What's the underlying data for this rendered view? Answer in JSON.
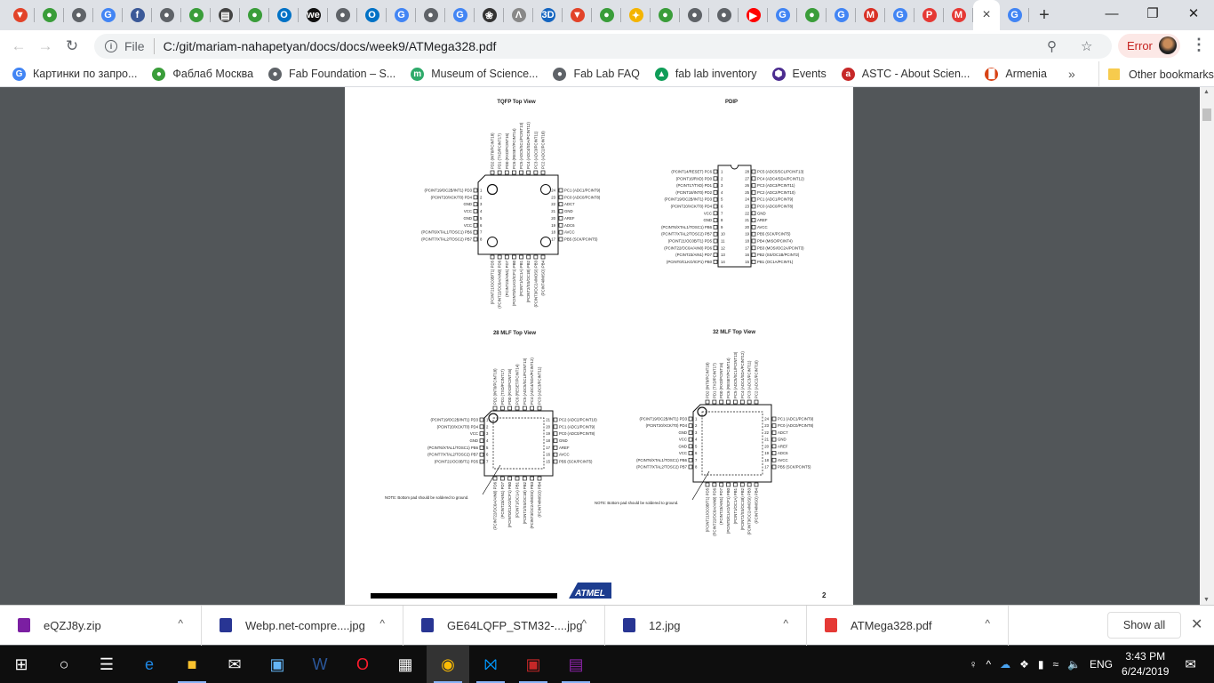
{
  "browser": {
    "tabs": [
      {
        "icon": "gitlab-icon",
        "color": "#e24329",
        "glyph": "▼"
      },
      {
        "icon": "fablab-icon",
        "color": "#3a9d3a",
        "glyph": "●"
      },
      {
        "icon": "globe-icon",
        "color": "#5f6368",
        "glyph": "●"
      },
      {
        "icon": "google-icon",
        "color": "#4285f4",
        "glyph": "G"
      },
      {
        "icon": "facebook-icon",
        "color": "#3b5998",
        "glyph": "f"
      },
      {
        "icon": "globe-icon",
        "color": "#5f6368",
        "glyph": "●"
      },
      {
        "icon": "fablab-icon",
        "color": "#3a9d3a",
        "glyph": "●"
      },
      {
        "icon": "book-icon",
        "color": "#444",
        "glyph": "▤"
      },
      {
        "icon": "fablab-icon",
        "color": "#3a9d3a",
        "glyph": "●"
      },
      {
        "icon": "outlook-icon",
        "color": "#0072c6",
        "glyph": "O"
      },
      {
        "icon": "we-icon",
        "color": "#111",
        "glyph": "we"
      },
      {
        "icon": "globe-icon",
        "color": "#5f6368",
        "glyph": "●"
      },
      {
        "icon": "outlook-icon",
        "color": "#0072c6",
        "glyph": "O"
      },
      {
        "icon": "google-translate-icon",
        "color": "#4285f4",
        "glyph": "G"
      },
      {
        "icon": "globe-icon",
        "color": "#5f6368",
        "glyph": "●"
      },
      {
        "icon": "google-icon",
        "color": "#4285f4",
        "glyph": "G"
      },
      {
        "icon": "reel-icon",
        "color": "#333",
        "glyph": "❀"
      },
      {
        "icon": "lambda-icon",
        "color": "#888",
        "glyph": "Λ"
      },
      {
        "icon": "3d-icon",
        "color": "#1565c0",
        "glyph": "3D"
      },
      {
        "icon": "gitlab-icon",
        "color": "#e24329",
        "glyph": "▼"
      },
      {
        "icon": "fablab-icon",
        "color": "#3a9d3a",
        "glyph": "●"
      },
      {
        "icon": "pinwheel-icon",
        "color": "#f4b400",
        "glyph": "✦"
      },
      {
        "icon": "fablab-icon",
        "color": "#3a9d3a",
        "glyph": "●"
      },
      {
        "icon": "globe-icon",
        "color": "#5f6368",
        "glyph": "●"
      },
      {
        "icon": "globe-icon",
        "color": "#5f6368",
        "glyph": "●"
      },
      {
        "icon": "youtube-icon",
        "color": "#ff0000",
        "glyph": "▶"
      },
      {
        "icon": "google-icon",
        "color": "#4285f4",
        "glyph": "G"
      },
      {
        "icon": "fablab-icon",
        "color": "#3a9d3a",
        "glyph": "●"
      },
      {
        "icon": "google-icon",
        "color": "#4285f4",
        "glyph": "G"
      },
      {
        "icon": "gmail-icon",
        "color": "#d93025",
        "glyph": "M"
      },
      {
        "icon": "google-icon",
        "color": "#4285f4",
        "glyph": "G"
      },
      {
        "icon": "pdf-icon",
        "color": "#e53935",
        "glyph": "P"
      },
      {
        "icon": "microchip-icon",
        "color": "#e53935",
        "glyph": "M"
      }
    ],
    "active_tab_close": "×",
    "after_tab": {
      "icon": "google-icon",
      "color": "#4285f4",
      "glyph": "G"
    },
    "new_tab": "+",
    "window": {
      "minimize": "—",
      "restore": "❐",
      "close": "✕"
    },
    "file_label": "File",
    "url": "C:/git/mariam-nahapetyan/docs/docs/week9/ATMega328.pdf",
    "profile_status": "Error",
    "bookmarks": [
      {
        "label": "Картинки по запро...",
        "icon": "google-icon",
        "color": "#4285f4",
        "glyph": "G"
      },
      {
        "label": "Фаблаб Москва",
        "icon": "fablab-icon",
        "color": "#3a9d3a",
        "glyph": "●"
      },
      {
        "label": "Fab Foundation – S...",
        "icon": "globe-icon",
        "color": "#5f6368",
        "glyph": "●"
      },
      {
        "label": "Museum of Science...",
        "icon": "museum-icon",
        "color": "#2eaa6a",
        "glyph": "m"
      },
      {
        "label": "Fab Lab FAQ",
        "icon": "globe-icon",
        "color": "#5f6368",
        "glyph": "●"
      },
      {
        "label": "fab lab inventory",
        "icon": "google-drive-icon",
        "color": "#0f9d58",
        "glyph": "▲"
      },
      {
        "label": "Events",
        "icon": "hexagon-icon",
        "color": "#4b2c8f",
        "glyph": "⬢"
      },
      {
        "label": "ASTC - About Scien...",
        "icon": "astc-icon",
        "color": "#c62828",
        "glyph": "a"
      },
      {
        "label": "Armenia",
        "icon": "armenia-icon",
        "color": "#d84315",
        "glyph": "█"
      }
    ],
    "bookmarks_more": "»",
    "other_bookmarks": "Other bookmarks"
  },
  "pdf": {
    "page_number": "2",
    "tqfp": {
      "title": "TQFP Top View",
      "pins": [
        "(PCINT19/OC2B/INT1) PD3",
        "(PCINT20/XCK/T0) PD4",
        "GND",
        "VCC",
        "GND",
        "VCC",
        "(PCINT6/XTAL1/TOSC1) PB6",
        "(PCINT7/XTAL2/TOSC2) PB7",
        "(PCINT21/OC0B/T1) PD5",
        "(PCINT22/OC0A/AIN0) PD6",
        "(PCINT23/AIN1) PD7",
        "(PCINT0/CLKO/ICP1) PB0",
        "(PCINT1/OC1A) PB1",
        "(PCINT2/SS/OC1B) PB2",
        "(PCINT3/OC2A/MOSI) PB3",
        "(PCINT4/MISO) PB4",
        "PB5 (SCK/PCINT5)",
        "AVCC",
        "ADC6",
        "AREF",
        "GND",
        "ADC7",
        "PC0 (ADC0/PCINT8)",
        "PC1 (ADC1/PCINT9)",
        "PC2 (ADC2/PCINT10)",
        "PC3 (ADC3/PCINT11)",
        "PC4 (ADC4/SDA/PCINT12)",
        "PC5 (ADC5/SCL/PCINT13)",
        "PC6 (RESET/PCINT14)",
        "PD0 (RXD/PCINT16)",
        "PD1 (TXD/PCINT17)",
        "PD2 (INT0/PCINT18)"
      ]
    },
    "pdip": {
      "title": "PDIP",
      "pins": [
        "(PCINT14/RESET) PC6",
        "(PCINT16/RXD) PD0",
        "(PCINT17/TXD) PD1",
        "(PCINT18/INT0) PD2",
        "(PCINT19/OC2B/INT1) PD3",
        "(PCINT20/XCK/T0) PD4",
        "VCC",
        "GND",
        "(PCINT6/XTAL1/TOSC1) PB6",
        "(PCINT7/XTAL2/TOSC2) PB7",
        "(PCINT21/OC0B/T1) PD5",
        "(PCINT22/OC0A/AIN0) PD6",
        "(PCINT23/AIN1) PD7",
        "(PCINT0/CLKO/ICP1) PB0",
        "PB1 (OC1A/PCINT1)",
        "PB2 (SS/OC1B/PCINT2)",
        "PB3 (MOSI/OC2A/PCINT3)",
        "PB4 (MISO/PCINT4)",
        "PB5 (SCK/PCINT5)",
        "AVCC",
        "AREF",
        "GND",
        "PC0 (ADC0/PCINT8)",
        "PC1 (ADC1/PCINT9)",
        "PC2 (ADC2/PCINT10)",
        "PC3 (ADC3/PCINT11)",
        "PC4 (ADC4/SDA/PCINT12)",
        "PC5 (ADC5/SCL/PCINT13)"
      ]
    },
    "mlf28": {
      "title": "28 MLF Top View",
      "note": "NOTE:  Bottom pad should be soldered to ground.",
      "pins": [
        "(PCINT19/OC2B/INT1) PD3",
        "(PCINT20/XCK/T0) PD4",
        "VCC",
        "GND",
        "(PCINT6/XTAL1/TOSC1) PB6",
        "(PCINT7/XTAL2/TOSC2) PB7",
        "(PCINT21/OC0B/T1) PD5",
        "(PCINT22/OC0A/AIN0) PD6",
        "(PCINT23/AIN1) PD7",
        "(PCINT0/CLKO/ICP1) PB0",
        "(PCINT1/OC1A) PB1",
        "(PCINT2/SS/OC1B) PB2",
        "(PCINT3/OC2A/MOSI) PB3",
        "(PCINT4/MISO) PB4",
        "PB5 (SCK/PCINT5)",
        "AVCC",
        "AREF",
        "GND",
        "PC0 (ADC0/PCINT8)",
        "PC1 (ADC1/PCINT9)",
        "PC2 (ADC2/PCINT10)",
        "PC3 (ADC3/PCINT11)",
        "PC4 (ADC4/SDA/PCINT12)",
        "PC5 (ADC5/SCL/PCINT13)",
        "PC6 (RESET/PCINT14)",
        "PD0 (RXD/PCINT16)",
        "PD1 (TXD/PCINT17)",
        "PD2 (INT0/PCINT18)"
      ]
    },
    "mlf32": {
      "title": "32 MLF Top View",
      "note": "NOTE:  Bottom pad should be soldered to ground.",
      "pins": [
        "(PCINT19/OC2B/INT1) PD3",
        "(PCINT20/XCK/T0) PD4",
        "GND",
        "VCC",
        "GND",
        "VCC",
        "(PCINT6/XTAL1/TOSC1) PB6",
        "(PCINT7/XTAL2/TOSC2) PB7",
        "(PCINT21/OC0B/T1) PD5",
        "(PCINT22/OC0A/AIN0) PD6",
        "(PCINT23/AIN1) PD7",
        "(PCINT0/CLKO/ICP1) PB0",
        "(PCINT1/OC1A) PB1",
        "(PCINT2/SS/OC1B) PB2",
        "(PCINT3/OC2A/MOSI) PB3",
        "(PCINT4/MISO) PB4",
        "PB5 (SCK/PCINT5)",
        "AVCC",
        "ADC6",
        "AREF",
        "GND",
        "ADC7",
        "PC0 (ADC0/PCINT8)",
        "PC1 (ADC1/PCINT9)",
        "PC2 (ADC2/PCINT10)",
        "PC3 (ADC3/PCINT11)",
        "PC4 (ADC4/SDA/PCINT12)",
        "PC5 (ADC5/SCL/PCINT13)",
        "PC6 (RESET/PCINT14)",
        "PD0 (RXD/PCINT16)",
        "PD1 (TXD/PCINT17)",
        "PD2 (INT0/PCINT18)"
      ]
    },
    "logo": "ATMEL"
  },
  "downloads": {
    "items": [
      {
        "name": "eQZJ8y.zip",
        "color": "#7b1fa2"
      },
      {
        "name": "Webp.net-compre....jpg",
        "color": "#283593"
      },
      {
        "name": "GE64LQFP_STM32-....jpg",
        "color": "#283593"
      },
      {
        "name": "12.jpg",
        "color": "#283593"
      },
      {
        "name": "ATMega328.pdf",
        "color": "#e53935"
      }
    ],
    "caret": "^",
    "show_all": "Show all",
    "close": "✕"
  },
  "taskbar": {
    "apps": [
      {
        "name": "start",
        "glyph": "⊞",
        "color": "#fff",
        "open": false
      },
      {
        "name": "cortana",
        "glyph": "○",
        "color": "#fff",
        "open": false
      },
      {
        "name": "task-view",
        "glyph": "☰",
        "color": "#fff",
        "open": false
      },
      {
        "name": "edge",
        "glyph": "e",
        "color": "#1e88e5",
        "open": false
      },
      {
        "name": "file-explorer",
        "glyph": "■",
        "color": "#f9c22e",
        "open": true
      },
      {
        "name": "mail",
        "glyph": "✉",
        "color": "#fff",
        "open": false
      },
      {
        "name": "remote",
        "glyph": "▣",
        "color": "#64b5f6",
        "open": false
      },
      {
        "name": "word",
        "glyph": "W",
        "color": "#2b579a",
        "open": false
      },
      {
        "name": "opera",
        "glyph": "O",
        "color": "#ff1b2d",
        "open": false
      },
      {
        "name": "store",
        "glyph": "▦",
        "color": "#fff",
        "open": false
      },
      {
        "name": "chrome",
        "glyph": "◉",
        "color": "#fbbc05",
        "open": true,
        "active": true
      },
      {
        "name": "vscode",
        "glyph": "⨝",
        "color": "#0098ff",
        "open": true
      },
      {
        "name": "image-viewer",
        "glyph": "▣",
        "color": "#c62828",
        "open": true
      },
      {
        "name": "winrar",
        "glyph": "▤",
        "color": "#8e24aa",
        "open": true
      }
    ],
    "tray": {
      "people": "♀",
      "chevron": "^",
      "language": "ENG",
      "time": "3:43 PM",
      "date": "6/24/2019",
      "notifications": "✉"
    }
  }
}
